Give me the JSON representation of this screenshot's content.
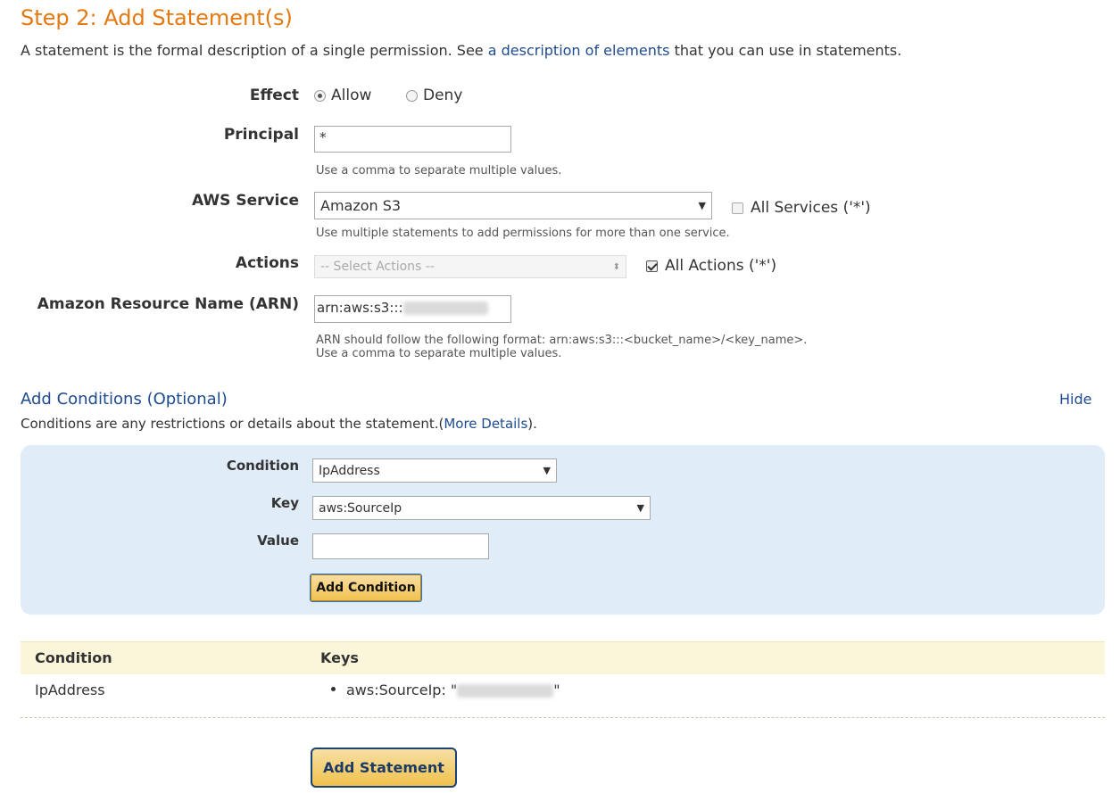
{
  "heading": "Step 2: Add Statement(s)",
  "intro": {
    "before": "A statement is the formal description of a single permission. See ",
    "link": "a description of elements",
    "after": " that you can use in statements."
  },
  "effect": {
    "label": "Effect",
    "options": [
      "Allow",
      "Deny"
    ],
    "selected": "Allow"
  },
  "principal": {
    "label": "Principal",
    "value": "*",
    "hint": "Use a comma to separate multiple values."
  },
  "aws_service": {
    "label": "AWS Service",
    "value": "Amazon S3",
    "all_services_label": "All Services ('*')",
    "all_services_checked": false,
    "hint": "Use multiple statements to add permissions for more than one service."
  },
  "actions": {
    "label": "Actions",
    "placeholder": "-- Select Actions --",
    "all_actions_label": "All Actions ('*')",
    "all_actions_checked": true
  },
  "arn": {
    "label": "Amazon Resource Name (ARN)",
    "value_prefix": "arn:aws:s3:::",
    "hint_line1": "ARN should follow the following format: arn:aws:s3:::<bucket_name>/<key_name>.",
    "hint_line2": "Use a comma to separate multiple values."
  },
  "conditions": {
    "heading": "Add Conditions (Optional)",
    "hide_label": "Hide",
    "desc_before": "Conditions are any restrictions or details about the statement.(",
    "desc_link": "More Details",
    "desc_after": ").",
    "condition_label": "Condition",
    "condition_value": "IpAddress",
    "key_label": "Key",
    "key_value": "aws:SourceIp",
    "value_label": "Value",
    "value_value": "",
    "add_button": "Add Condition"
  },
  "conditions_table": {
    "headers": [
      "Condition",
      "Keys"
    ],
    "rows": [
      {
        "condition": "IpAddress",
        "key_prefix": "aws:SourceIp: \"",
        "key_suffix": "\""
      }
    ]
  },
  "add_statement_button": "Add Statement"
}
